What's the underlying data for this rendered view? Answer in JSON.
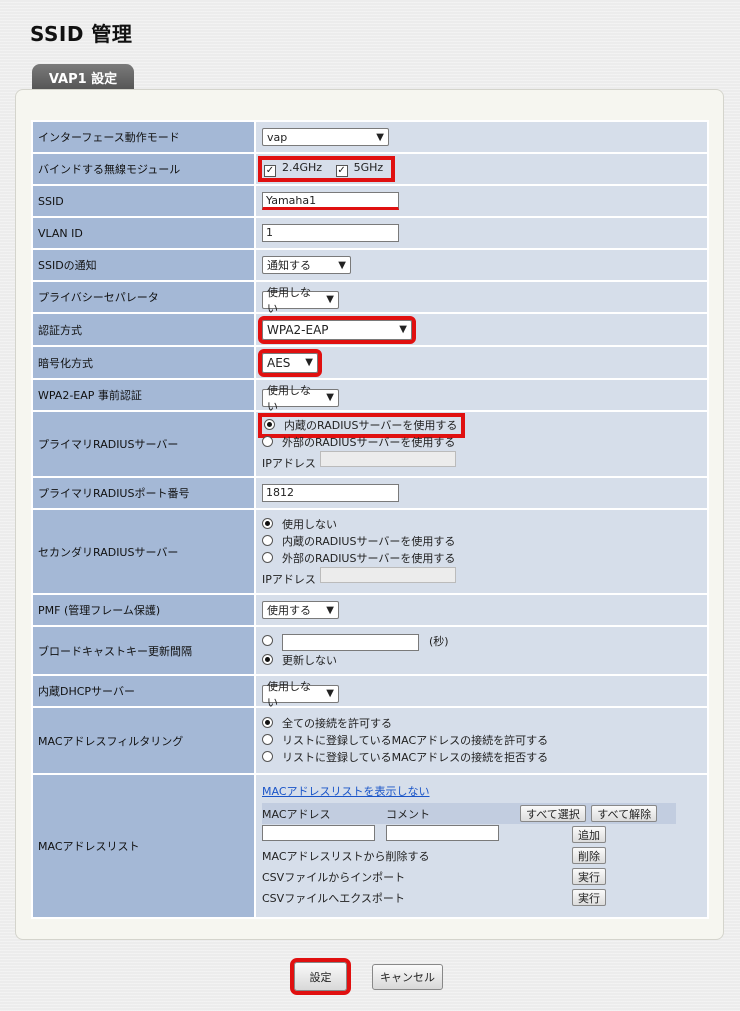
{
  "page": {
    "title": "SSID 管理",
    "tab_label": "VAP1 設定"
  },
  "rows": {
    "mode": {
      "label": "インターフェース動作モード",
      "value": "vap"
    },
    "bind": {
      "label": "バインドする無線モジュール",
      "opt_24": "2.4GHz",
      "opt_5": "5GHz",
      "checked_24": true,
      "checked_5": true
    },
    "ssid": {
      "label": "SSID",
      "value": "Yamaha1"
    },
    "vlan": {
      "label": "VLAN ID",
      "value": "1"
    },
    "notify": {
      "label": "SSIDの通知",
      "value": "通知する"
    },
    "privacy": {
      "label": "プライバシーセパレータ",
      "value": "使用しない"
    },
    "auth": {
      "label": "認証方式",
      "value": "WPA2-EAP"
    },
    "cipher": {
      "label": "暗号化方式",
      "value": "AES"
    },
    "preauth": {
      "label": "WPA2-EAP 事前認証",
      "value": "使用しない"
    },
    "primary_radius": {
      "label": "プライマリRADIUSサーバー",
      "opt_internal": "内蔵のRADIUSサーバーを使用する",
      "opt_external": "外部のRADIUSサーバーを使用する",
      "ip_label": "IPアドレス",
      "selected": "internal"
    },
    "primary_port": {
      "label": "プライマリRADIUSポート番号",
      "value": "1812"
    },
    "secondary_radius": {
      "label": "セカンダリRADIUSサーバー",
      "opt_none": "使用しない",
      "opt_internal": "内蔵のRADIUSサーバーを使用する",
      "opt_external": "外部のRADIUSサーバーを使用する",
      "ip_label": "IPアドレス",
      "selected": "none"
    },
    "pmf": {
      "label": "PMF (管理フレーム保護)",
      "value": "使用する"
    },
    "broadcast": {
      "label": "ブロードキャストキー更新間隔",
      "unit": "(秒)",
      "opt_none": "更新しない",
      "selected": "none"
    },
    "dhcp": {
      "label": "内蔵DHCPサーバー",
      "value": "使用しない"
    },
    "macfilter": {
      "label": "MACアドレスフィルタリング",
      "opt_all": "全ての接続を許可する",
      "opt_allow": "リストに登録しているMACアドレスの接続を許可する",
      "opt_deny": "リストに登録しているMACアドレスの接続を拒否する",
      "selected": "all"
    },
    "maclist": {
      "label": "MACアドレスリスト",
      "toggle_link": "MACアドレスリストを表示しない",
      "col_mac": "MACアドレス",
      "col_comment": "コメント",
      "select_all": "すべて選択",
      "deselect_all": "すべて解除",
      "add": "追加",
      "delete_label": "MACアドレスリストから削除する",
      "delete_btn": "削除",
      "import_label": "CSVファイルからインポート",
      "import_btn": "実行",
      "export_label": "CSVファイルへエクスポート",
      "export_btn": "実行"
    }
  },
  "footer": {
    "submit": "設定",
    "cancel": "キャンセル"
  },
  "colors": {
    "label_bg": "#a4b8d6",
    "value_bg": "#d6deea",
    "highlight": "#e01010"
  }
}
